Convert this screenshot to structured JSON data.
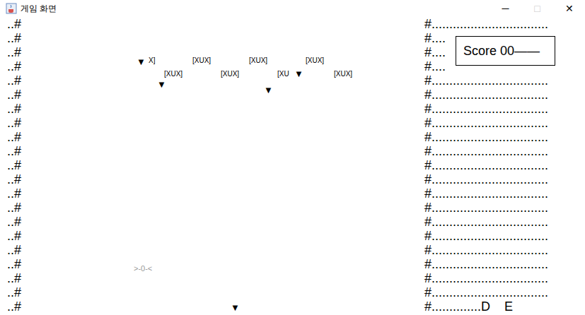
{
  "window": {
    "title": "게임 화면",
    "controls": [
      {
        "label": "─",
        "disabled": false
      },
      {
        "label": "□",
        "disabled": true
      },
      {
        "label": "✕",
        "disabled": false
      }
    ]
  },
  "left_wall": [
    "..#",
    "..#",
    "..#",
    "..#",
    "..#",
    "..#",
    "..#",
    "..#",
    "..#",
    "..#",
    "..#",
    "..#",
    "..#",
    "..#",
    "..#",
    "..#",
    "..#",
    "..#",
    "..#",
    "..#",
    "..#"
  ],
  "right_wall": [
    "#.................................",
    "#....",
    "#....",
    "#....",
    "#.................................",
    "#.................................",
    "#.................................",
    "#.................................",
    "#.................................",
    "#.................................",
    "#.................................",
    "#.................................",
    "#.................................",
    "#.................................",
    "#.................................",
    "#.................................",
    "#.................................",
    "#.................................",
    "#.................................",
    "#.................................",
    "#..............D    E"
  ],
  "score": {
    "label": "Score 00——"
  },
  "enemies": [
    {
      "text": "X]"
    },
    {
      "text": "[XUX]"
    },
    {
      "text": "[XUX]"
    },
    {
      "text": "[XUX]"
    },
    {
      "text": "[XUX]"
    },
    {
      "text": "[XUX]"
    },
    {
      "text": "[XU"
    },
    {
      "text": "[XUX]"
    }
  ],
  "bombs": [
    {
      "glyph": "▼"
    },
    {
      "glyph": "▼"
    },
    {
      "glyph": "▼"
    },
    {
      "glyph": "▼"
    },
    {
      "glyph": "▼"
    }
  ],
  "player": {
    "text": ">-0-<"
  }
}
